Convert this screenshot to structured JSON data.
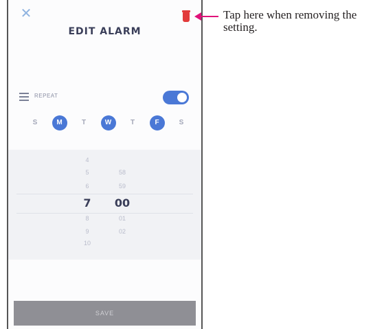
{
  "screen": {
    "title": "EDIT ALARM",
    "close_icon_glyph": "✕",
    "delete_icon": "trash-icon"
  },
  "repeat": {
    "label": "REPEAT",
    "enabled": true
  },
  "days": [
    {
      "label": "S",
      "active": false
    },
    {
      "label": "M",
      "active": true
    },
    {
      "label": "T",
      "active": false
    },
    {
      "label": "W",
      "active": true
    },
    {
      "label": "T",
      "active": false
    },
    {
      "label": "F",
      "active": true
    },
    {
      "label": "S",
      "active": false
    }
  ],
  "time_picker": {
    "hours": [
      "4",
      "5",
      "6",
      "7",
      "8",
      "9",
      "10"
    ],
    "minutes": [
      "58",
      "59",
      "00",
      "01",
      "02"
    ],
    "selected_hour": "7",
    "selected_minute": "00"
  },
  "save_button": {
    "label": "SAVE"
  },
  "annotation": {
    "text": "Tap here when removing the setting."
  },
  "colors": {
    "accent": "#4a78d6",
    "delete": "#e23b3b",
    "callout": "#e0127a"
  }
}
